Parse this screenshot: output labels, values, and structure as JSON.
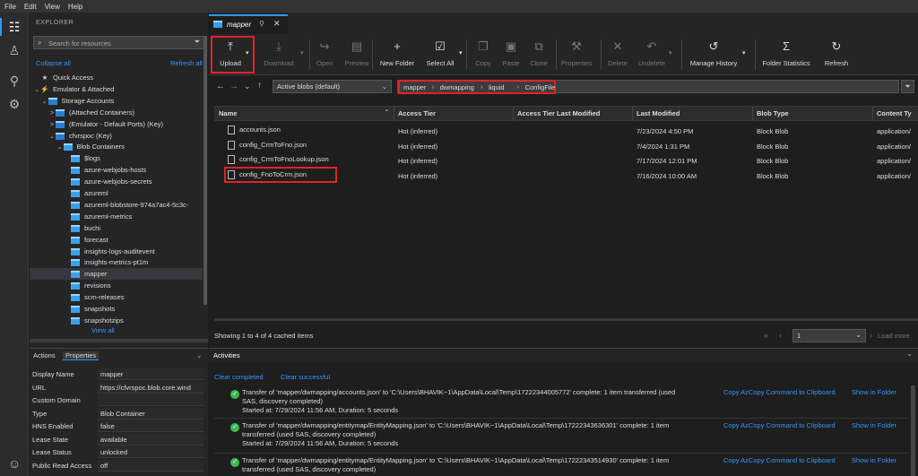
{
  "menu": [
    "File",
    "Edit",
    "View",
    "Help"
  ],
  "explorer": {
    "title": "EXPLORER",
    "search_placeholder": "Search for resources",
    "collapse_all": "Collapse all",
    "refresh_all": "Refresh all",
    "tree": [
      {
        "label": "Quick Access",
        "icon": "star-icon",
        "indent": 0,
        "chev": ""
      },
      {
        "label": "Emulator & Attached",
        "icon": "plug-icon",
        "indent": 0,
        "chev": "∨"
      },
      {
        "label": "Storage Accounts",
        "icon": "storage-icon",
        "indent": 1,
        "chev": "∨"
      },
      {
        "label": "(Attached Containers)",
        "icon": "storage-icon",
        "indent": 2,
        "chev": ">"
      },
      {
        "label": "(Emulator - Default Ports) (Key)",
        "icon": "storage-icon",
        "indent": 2,
        "chev": ">"
      },
      {
        "label": "cfvrspoc (Key)",
        "icon": "storage-icon",
        "indent": 2,
        "chev": "∨"
      },
      {
        "label": "Blob Containers",
        "icon": "container-icon",
        "indent": 3,
        "chev": "∨"
      },
      {
        "label": "$logs",
        "icon": "container-icon",
        "indent": 4,
        "chev": ""
      },
      {
        "label": "azure-webjobs-hosts",
        "icon": "container-icon",
        "indent": 4,
        "chev": ""
      },
      {
        "label": "azure-webjobs-secrets",
        "icon": "container-icon",
        "indent": 4,
        "chev": ""
      },
      {
        "label": "azureml",
        "icon": "container-icon",
        "indent": 4,
        "chev": ""
      },
      {
        "label": "azureml-blobstore-974a7ac4-5c3c-",
        "icon": "container-icon",
        "indent": 4,
        "chev": ""
      },
      {
        "label": "azureml-metrics",
        "icon": "container-icon",
        "indent": 4,
        "chev": ""
      },
      {
        "label": "buchi",
        "icon": "container-icon",
        "indent": 4,
        "chev": ""
      },
      {
        "label": "forecast",
        "icon": "container-icon",
        "indent": 4,
        "chev": ""
      },
      {
        "label": "insights-logs-auditevent",
        "icon": "container-icon",
        "indent": 4,
        "chev": ""
      },
      {
        "label": "insights-metrics-pt1m",
        "icon": "container-icon",
        "indent": 4,
        "chev": ""
      },
      {
        "label": "mapper",
        "icon": "container-icon",
        "indent": 4,
        "chev": "",
        "selected": true
      },
      {
        "label": "revisions",
        "icon": "container-icon",
        "indent": 4,
        "chev": ""
      },
      {
        "label": "scm-releases",
        "icon": "container-icon",
        "indent": 4,
        "chev": ""
      },
      {
        "label": "snapshots",
        "icon": "container-icon",
        "indent": 4,
        "chev": ""
      },
      {
        "label": "snapshotzips",
        "icon": "container-icon",
        "indent": 4,
        "chev": ""
      }
    ],
    "view_all": "View all"
  },
  "properties": {
    "tab_actions": "Actions",
    "tab_properties": "Properties",
    "rows": [
      {
        "key": "Display Name",
        "value": "mapper"
      },
      {
        "key": "URL",
        "value": "https://cfvrspoc.blob.core.wind"
      },
      {
        "key": "Custom Domain",
        "value": ""
      },
      {
        "key": "Type",
        "value": "Blob Container"
      },
      {
        "key": "HNS Enabled",
        "value": "false"
      },
      {
        "key": "Lease State",
        "value": "available"
      },
      {
        "key": "Lease Status",
        "value": "unlocked"
      },
      {
        "key": "Public Read Access",
        "value": "off"
      }
    ]
  },
  "tab": {
    "label": "mapper"
  },
  "toolbar": [
    {
      "label": "Upload",
      "icon": "upload-icon",
      "glyph": "⤒",
      "enabled": true,
      "dropdown": true
    },
    {
      "label": "Download",
      "icon": "download-icon",
      "glyph": "⤓",
      "enabled": false,
      "dropdown": true
    },
    {
      "label": "Open",
      "icon": "open-icon",
      "glyph": "↪",
      "enabled": false
    },
    {
      "label": "Preview",
      "icon": "preview-icon",
      "glyph": "▤",
      "enabled": false
    },
    {
      "label": "New Folder",
      "icon": "plus-icon",
      "glyph": "+",
      "enabled": true
    },
    {
      "label": "Select All",
      "icon": "select-all-icon",
      "glyph": "☑",
      "enabled": true,
      "dropdown": true
    },
    {
      "label": "Copy",
      "icon": "copy-icon",
      "glyph": "❐",
      "enabled": false
    },
    {
      "label": "Paste",
      "icon": "paste-icon",
      "glyph": "▣",
      "enabled": false
    },
    {
      "label": "Clone",
      "icon": "clone-icon",
      "glyph": "⧉",
      "enabled": false
    },
    {
      "label": "Properties",
      "icon": "wrench-icon",
      "glyph": "⚒",
      "enabled": false
    },
    {
      "label": "Delete",
      "icon": "delete-icon",
      "glyph": "✕",
      "enabled": false
    },
    {
      "label": "Undelete",
      "icon": "undo-icon",
      "glyph": "↶",
      "enabled": false,
      "dropdown": true
    },
    {
      "label": "Manage History",
      "icon": "history-icon",
      "glyph": "↺",
      "enabled": true,
      "dropdown": true
    },
    {
      "label": "Folder Statistics",
      "icon": "sigma-icon",
      "glyph": "Σ",
      "enabled": true
    },
    {
      "label": "Refresh",
      "icon": "refresh-icon",
      "glyph": "↻",
      "enabled": true
    }
  ],
  "nav": {
    "blob_view": "Active blobs (default)",
    "crumbs": [
      "mapper",
      "dwmapping",
      "liquid",
      "ConfigFile"
    ]
  },
  "grid": {
    "headers": [
      "Name",
      "Access Tier",
      "Access Tier Last Modified",
      "Last Modified",
      "Blob Type",
      "Content Ty"
    ],
    "rows": [
      {
        "name": "accounts.json",
        "tier": "Hot (inferred)",
        "tier_mod": "",
        "modified": "7/23/2024 4:50 PM",
        "type": "Block Blob",
        "content": "application/"
      },
      {
        "name": "config_CrmToFno.json",
        "tier": "Hot (inferred)",
        "tier_mod": "",
        "modified": "7/4/2024 1:31 PM",
        "type": "Block Blob",
        "content": "application/"
      },
      {
        "name": "config_CrmToFnoLookup.json",
        "tier": "Hot (inferred)",
        "tier_mod": "",
        "modified": "7/17/2024 12:01 PM",
        "type": "Block Blob",
        "content": "application/"
      },
      {
        "name": "config_FnoToCrm.json",
        "tier": "Hot (inferred)",
        "tier_mod": "",
        "modified": "7/16/2024 10:00 AM",
        "type": "Block Blob",
        "content": "application/"
      }
    ],
    "status": "Showing 1 to 4 of 4 cached items",
    "page": "1",
    "load_more": "Load more"
  },
  "activities": {
    "title": "Activities",
    "clear_completed": "Clear completed",
    "clear_successful": "Clear successful",
    "items": [
      {
        "line1": "Transfer of 'mapper/dwmapping/accounts.json' to 'C:\\Users\\BHAVIK~1\\AppData\\Local\\Temp\\17222344005772' complete: 1 item transferred (used",
        "line2": "SAS, discovery completed)",
        "line3": "Started at: 7/29/2024 11:56 AM, Duration: 5 seconds"
      },
      {
        "line1": "Transfer of 'mapper/dwmapping/entitymap/EntityMapping.json' to 'C:\\Users\\BHAVIK~1\\AppData\\Local\\Temp\\17222343636301' complete: 1 item",
        "line2": "transferred (used SAS, discovery completed)",
        "line3": "Started at: 7/29/2024 11:56 AM, Duration: 5 seconds"
      },
      {
        "line1": "Transfer of 'mapper/dwmapping/entitymap/EntityMapping.json' to 'C:\\Users\\BHAVIK~1\\AppData\\Local\\Temp\\17222343514930' complete: 1 item",
        "line2": "transferred (used SAS, discovery completed)",
        "line3": ""
      }
    ],
    "link_copy": "Copy AzCopy Command to Clipboard",
    "link_show": "Show in Folder"
  },
  "colors": {
    "accent": "#2b9af3",
    "highlight": "#e0222a",
    "success": "#3fb950",
    "link": "#3794ff"
  }
}
